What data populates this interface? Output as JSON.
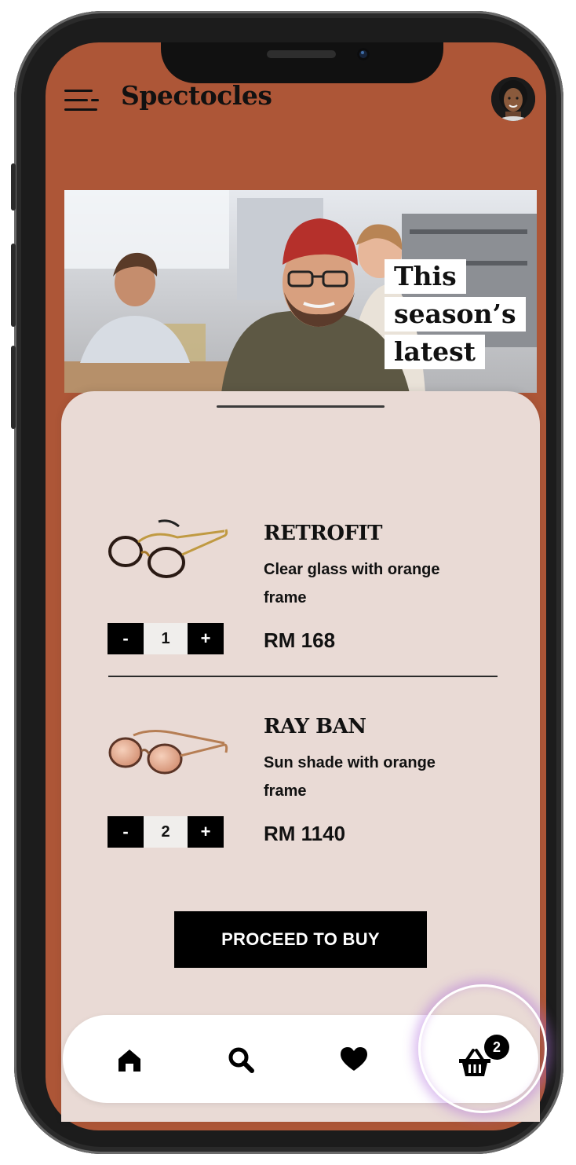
{
  "header": {
    "brand": "Spectocles",
    "menu_icon": "hamburger-menu-icon",
    "avatar_icon": "user-avatar"
  },
  "hero": {
    "lines": [
      "This",
      "season’s",
      "latest"
    ]
  },
  "cart": {
    "items": [
      {
        "name": "RETROFIT",
        "description": "Clear glass with orange frame",
        "price": "RM 168",
        "quantity": "1",
        "decrement_label": "-",
        "increment_label": "+"
      },
      {
        "name": "RAY BAN",
        "description": "Sun shade with orange frame",
        "price": "RM 1140",
        "quantity": "2",
        "decrement_label": "-",
        "increment_label": "+"
      }
    ],
    "proceed_label": "PROCEED TO BUY"
  },
  "bottom_nav": {
    "items": [
      {
        "icon": "home-icon"
      },
      {
        "icon": "search-icon"
      },
      {
        "icon": "heart-icon"
      },
      {
        "icon": "cart-basket-icon"
      }
    ],
    "cart_badge": "2"
  },
  "colors": {
    "brand_background": "#ad5637",
    "sheet_background": "#e9dad5",
    "button": "#000000",
    "highlight_ring": "#b06edc"
  }
}
